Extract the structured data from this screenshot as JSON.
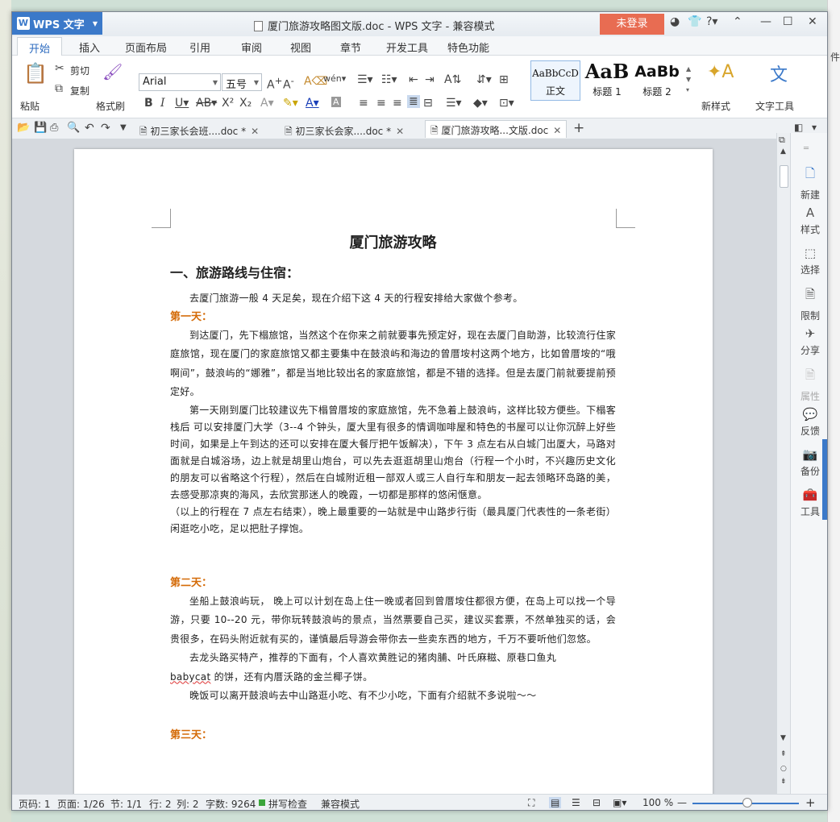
{
  "app": {
    "name": "WPS 文字",
    "window_title": "厦门旅游攻略图文版.doc - WPS 文字 - 兼容模式",
    "login_label": "未登录"
  },
  "ribbon_tabs": [
    "开始",
    "插入",
    "页面布局",
    "引用",
    "审阅",
    "视图",
    "章节",
    "开发工具",
    "特色功能"
  ],
  "ribbon": {
    "paste": "粘贴",
    "cut": "剪切",
    "copy": "复制",
    "format_painter": "格式刷",
    "font_name": "Arial",
    "font_size": "五号",
    "styles": [
      {
        "preview": "AaBbCcD",
        "label": "正文"
      },
      {
        "preview": "AaB",
        "label": "标题 1"
      },
      {
        "preview": "AaBb",
        "label": "标题 2"
      }
    ],
    "new_style": "新样式",
    "text_tools": "文字工具"
  },
  "doc_tabs": [
    {
      "label": "初三家长会班....doc *"
    },
    {
      "label": "初三家长会家....doc *"
    },
    {
      "label": "厦门旅游攻略...文版.doc"
    }
  ],
  "document": {
    "title": "厦门旅游攻略",
    "h1": "一、旅游路线与住宿：",
    "intro": "去厦门旅游一般 4 天足矣，现在介绍下这 4 天的行程安排给大家做个参考。",
    "day1": "第一天：",
    "p1": "到达厦门，先下榻旅馆，当然这个在你来之前就要事先预定好，现在去厦门自助游，比较流行住家庭旅馆，现在厦门的家庭旅馆又都主要集中在鼓浪屿和海边的曾厝垵村这两个地方，比如曾厝垵的“哦啊间”，鼓浪屿的“娜雅”，都是当地比较出名的家庭旅馆，都是不错的选择。但是去厦门前就要提前预定好。",
    "p2": "第一天刚到厦门比较建议先下榻曾厝垵的家庭旅馆，先不急着上鼓浪屿，这样比较方便些。下榻客栈后 可以安排厦门大学（3--4 个钟头，厦大里有很多的情调咖啡屋和特色的书屋可以让你沉醉上好些时间，如果是上午到达的还可以安排在厦大餐厅把午饭解决），下午 3 点左右从白城门出厦大，马路对面就是白城浴场，边上就是胡里山炮台，可以先去逛逛胡里山炮台（行程一个小时，不兴趣历史文化的朋友可以省略这个行程），然后在白城附近租一部双人或三人自行车和朋友一起去领略环岛路的美，去感受那凉爽的海风，去欣赏那迷人的晚霞，一切都是那样的悠闲惬意。",
    "p3": "（以上的行程在 7 点左右结束），晚上最重要的一站就是中山路步行街（最具厦门代表性的一条老街）闲逛吃小吃，足以把肚子撑饱。",
    "day2": "第二天：",
    "p4": "坐船上鼓浪屿玩， 晚上可以计划在岛上住一晚或者回到曾厝垵住都很方便，在岛上可以找一个导游，只要 10--20 元，带你玩转鼓浪屿的景点，当然票要自己买，建议买套票，不然单独买的话，会贵很多，在码头附近就有买的，谨慎最后导游会带你去一些卖东西的地方，千万不要听他们忽悠。",
    "p5a": "去龙头路买特产，推荐的下面有，个人喜欢黄胜记的猪肉脯、叶氏麻糍、原巷口鱼丸",
    "p5b_link": "babycat",
    "p5b": " 的饼，还有内厝沃路的金兰椰子饼。",
    "p6": "晚饭可以离开鼓浪屿去中山路逛小吃、有不少小吃，下面有介绍就不多说啦～～",
    "day3": "第三天："
  },
  "side_panel": [
    "新建",
    "样式",
    "选择",
    "限制",
    "分享",
    "属性",
    "反馈",
    "备份",
    "工具"
  ],
  "status": {
    "page_code": "页码: 1",
    "pages": "页面: 1/26",
    "section": "节: 1/1",
    "row": "行: 2",
    "col": "列: 2",
    "wordcount": "字数: 9264",
    "spell": "拼写检查",
    "mode": "兼容模式",
    "zoom": "100 %"
  },
  "colors": {
    "accent": "#3b79c9",
    "login": "#e86c52",
    "heading_day": "#d46b08"
  }
}
